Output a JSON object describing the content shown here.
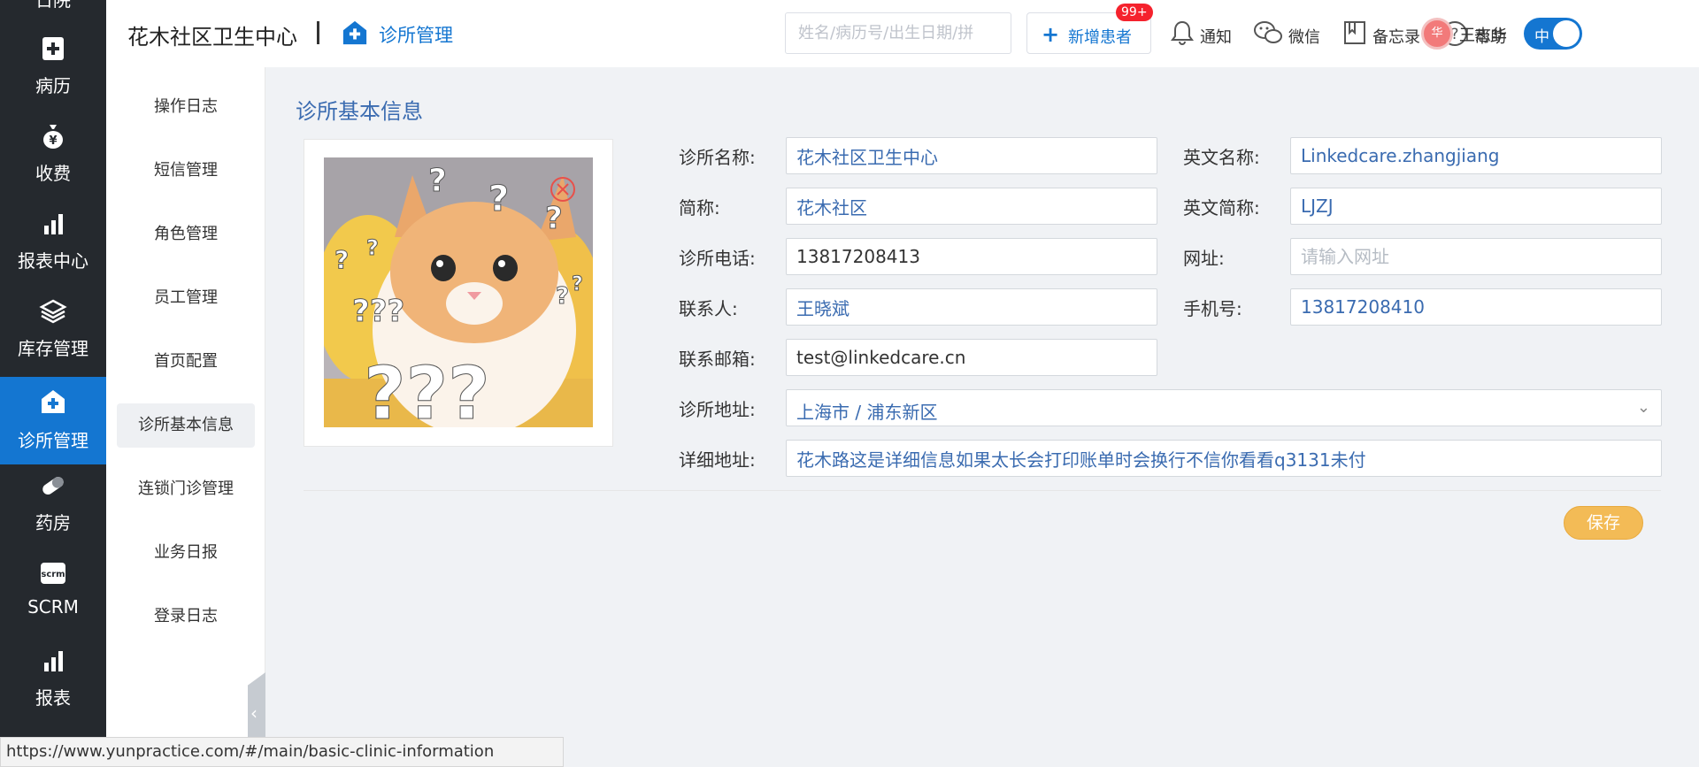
{
  "left_nav": {
    "top_partial_label": "日院",
    "items": [
      {
        "label": "病历",
        "icon": "medical-record-icon"
      },
      {
        "label": "收费",
        "icon": "money-bag-icon"
      },
      {
        "label": "报表中心",
        "icon": "bar-chart-icon"
      },
      {
        "label": "库存管理",
        "icon": "layers-icon"
      },
      {
        "label": "诊所管理",
        "icon": "clinic-icon",
        "active": true
      },
      {
        "label": "药房",
        "icon": "pill-icon"
      },
      {
        "label": "SCRM",
        "icon": "scrm-icon",
        "icon_text": "scrm"
      },
      {
        "label": "报表",
        "icon": "bar-chart-icon"
      }
    ],
    "active_color": "#1476d1",
    "background": "#25292e"
  },
  "header": {
    "clinic_name": "花木社区卫生中心",
    "module_name": "诊所管理",
    "search_placeholder": "姓名/病历号/出生日期/拼",
    "add_patient_label": "新增患者",
    "notification_label": "通知",
    "notification_badge": "99+",
    "wechat_label": "微信",
    "memo_label": "备忘录",
    "help_label": "帮助",
    "user_avatar_text": "华",
    "user_name": "王志华",
    "language_toggle": "中"
  },
  "submenu": {
    "items": [
      {
        "label": "操作日志"
      },
      {
        "label": "短信管理"
      },
      {
        "label": "角色管理"
      },
      {
        "label": "员工管理"
      },
      {
        "label": "首页配置"
      },
      {
        "label": "诊所基本信息",
        "active": true
      },
      {
        "label": "连锁门诊管理"
      },
      {
        "label": "业务日报"
      },
      {
        "label": "登录日志"
      }
    ]
  },
  "main": {
    "title": "诊所基本信息",
    "form": {
      "clinic_name_label": "诊所名称:",
      "clinic_name_value": "花木社区卫生中心",
      "english_name_label": "英文名称:",
      "english_name_value": "Linkedcare.zhangjiang",
      "short_name_label": "简称:",
      "short_name_value": "花木社区",
      "english_short_label": "英文简称:",
      "english_short_value": "LJZJ",
      "phone_label": "诊所电话:",
      "phone_value": "13817208413",
      "website_label": "网址:",
      "website_placeholder": "请输入网址",
      "contact_label": "联系人:",
      "contact_value": "王晓斌",
      "mobile_label": "手机号:",
      "mobile_value": "13817208410",
      "email_label": "联系邮箱:",
      "email_value": "test@linkedcare.cn",
      "address_label": "诊所地址:",
      "address_value": "上海市 / 浦东新区",
      "detail_address_label": "详细地址:",
      "detail_address_value": "花木路这是详细信息如果太长会打印账单时会换行不信你看看q3131未付"
    },
    "save_label": "保存",
    "save_color": "#f3bb56"
  },
  "status_bar": {
    "url": "https://www.yunpractice.com/#/main/basic-clinic-information"
  }
}
